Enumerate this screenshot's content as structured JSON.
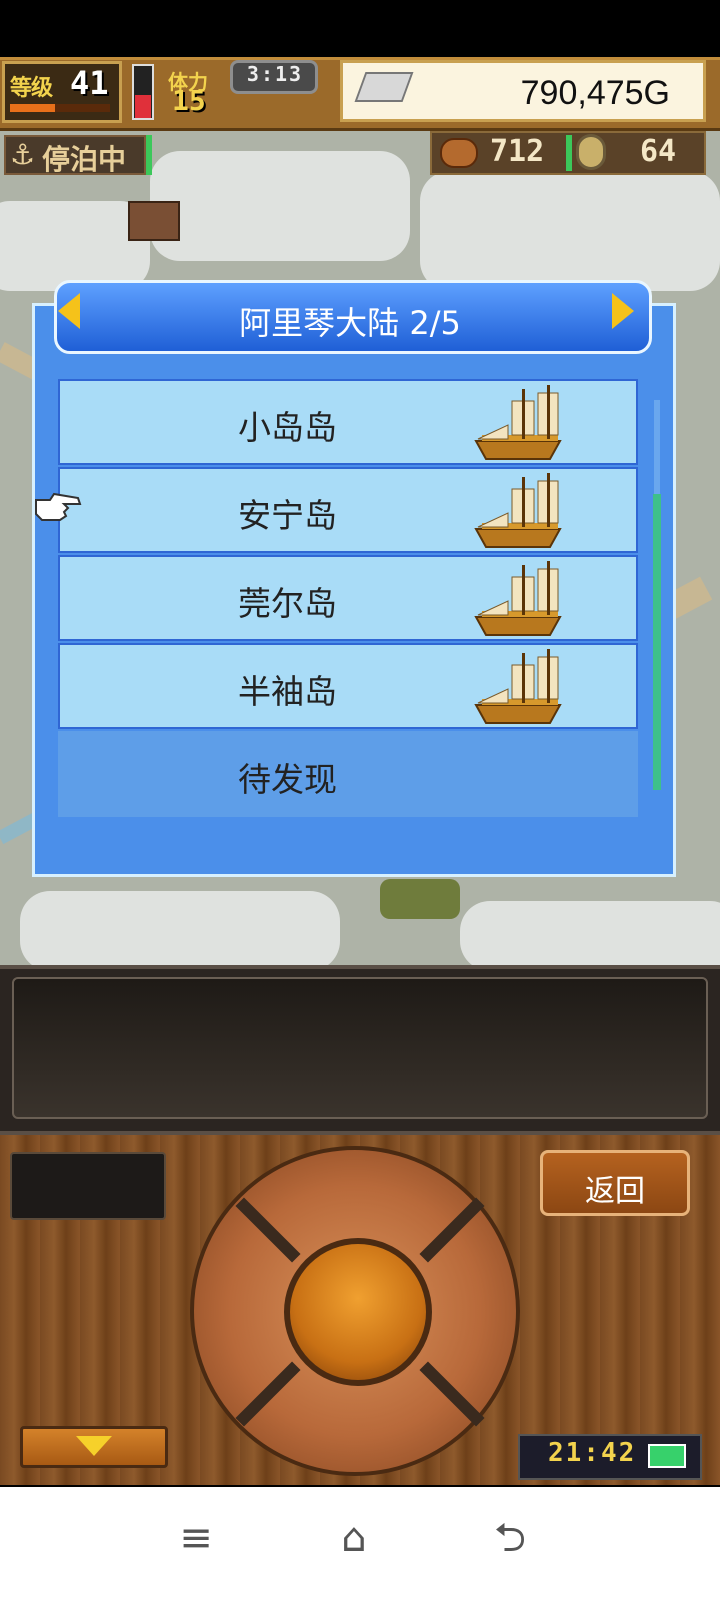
{
  "hud": {
    "level_label": "等级",
    "level_value": "41",
    "level_progress": 0.45,
    "hp_level": 0.45,
    "crew_label": "体力",
    "crew_value": "15",
    "game_time": "3:13",
    "money": "790,475G"
  },
  "status": {
    "docked_label": "停泊中",
    "food_value": "712",
    "coin_value": "64"
  },
  "dialog": {
    "title": "阿里琴大陆 2/5",
    "rows": [
      {
        "label": "小岛岛",
        "has_ship": true
      },
      {
        "label": "安宁岛",
        "has_ship": true
      },
      {
        "label": "莞尔岛",
        "has_ship": true
      },
      {
        "label": "半袖岛",
        "has_ship": true
      },
      {
        "label": "待发现",
        "has_ship": false
      }
    ]
  },
  "controls": {
    "back_label": "返回",
    "clock": "21:42"
  },
  "icons": {
    "anchor": "anchor-icon",
    "ingot": "silver-ingot-icon",
    "ship": "sailing-ship-icon",
    "pointer": "pointing-hand-icon",
    "battery": "battery-icon"
  },
  "colors": {
    "dialog_blue": "#4b8fea",
    "row_light_blue": "#a9dcf7",
    "gold": "#f5c21a",
    "wood": "#8e5a2c"
  }
}
